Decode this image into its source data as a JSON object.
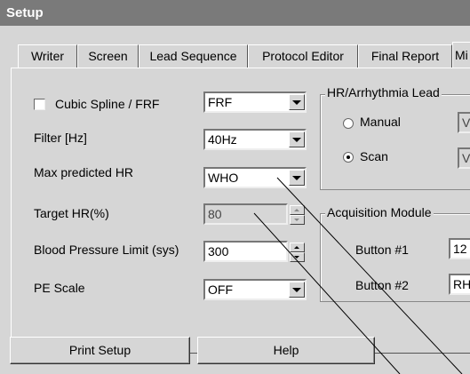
{
  "window": {
    "title": "Setup"
  },
  "tabs": [
    "Writer",
    "Screen",
    "Lead Sequence",
    "Protocol Editor",
    "Final Report",
    "Mi"
  ],
  "settings": {
    "cubic_spline": {
      "label": "Cubic Spline / FRF",
      "checked": false,
      "value": "FRF"
    },
    "filter": {
      "label": "Filter [Hz]",
      "value": "40Hz"
    },
    "max_hr": {
      "label": "Max predicted HR",
      "value": "WHO"
    },
    "target_hr": {
      "label": "Target HR(%)",
      "value": "80"
    },
    "bp_limit": {
      "label": "Blood Pressure Limit (sys)",
      "value": "300"
    },
    "pe_scale": {
      "label": "PE Scale",
      "value": "OFF"
    }
  },
  "hr_group": {
    "title": "HR/Arrhythmia Lead",
    "options": [
      {
        "label": "Manual",
        "selected": false,
        "value": "V"
      },
      {
        "label": "Scan",
        "selected": true,
        "value": "V"
      }
    ]
  },
  "acq_group": {
    "title": "Acquisition Module",
    "buttons": [
      {
        "label": "Button #1",
        "value": "12"
      },
      {
        "label": "Button #2",
        "value": "RH"
      }
    ]
  },
  "footer": {
    "print_setup": "Print Setup",
    "help": "Help"
  }
}
